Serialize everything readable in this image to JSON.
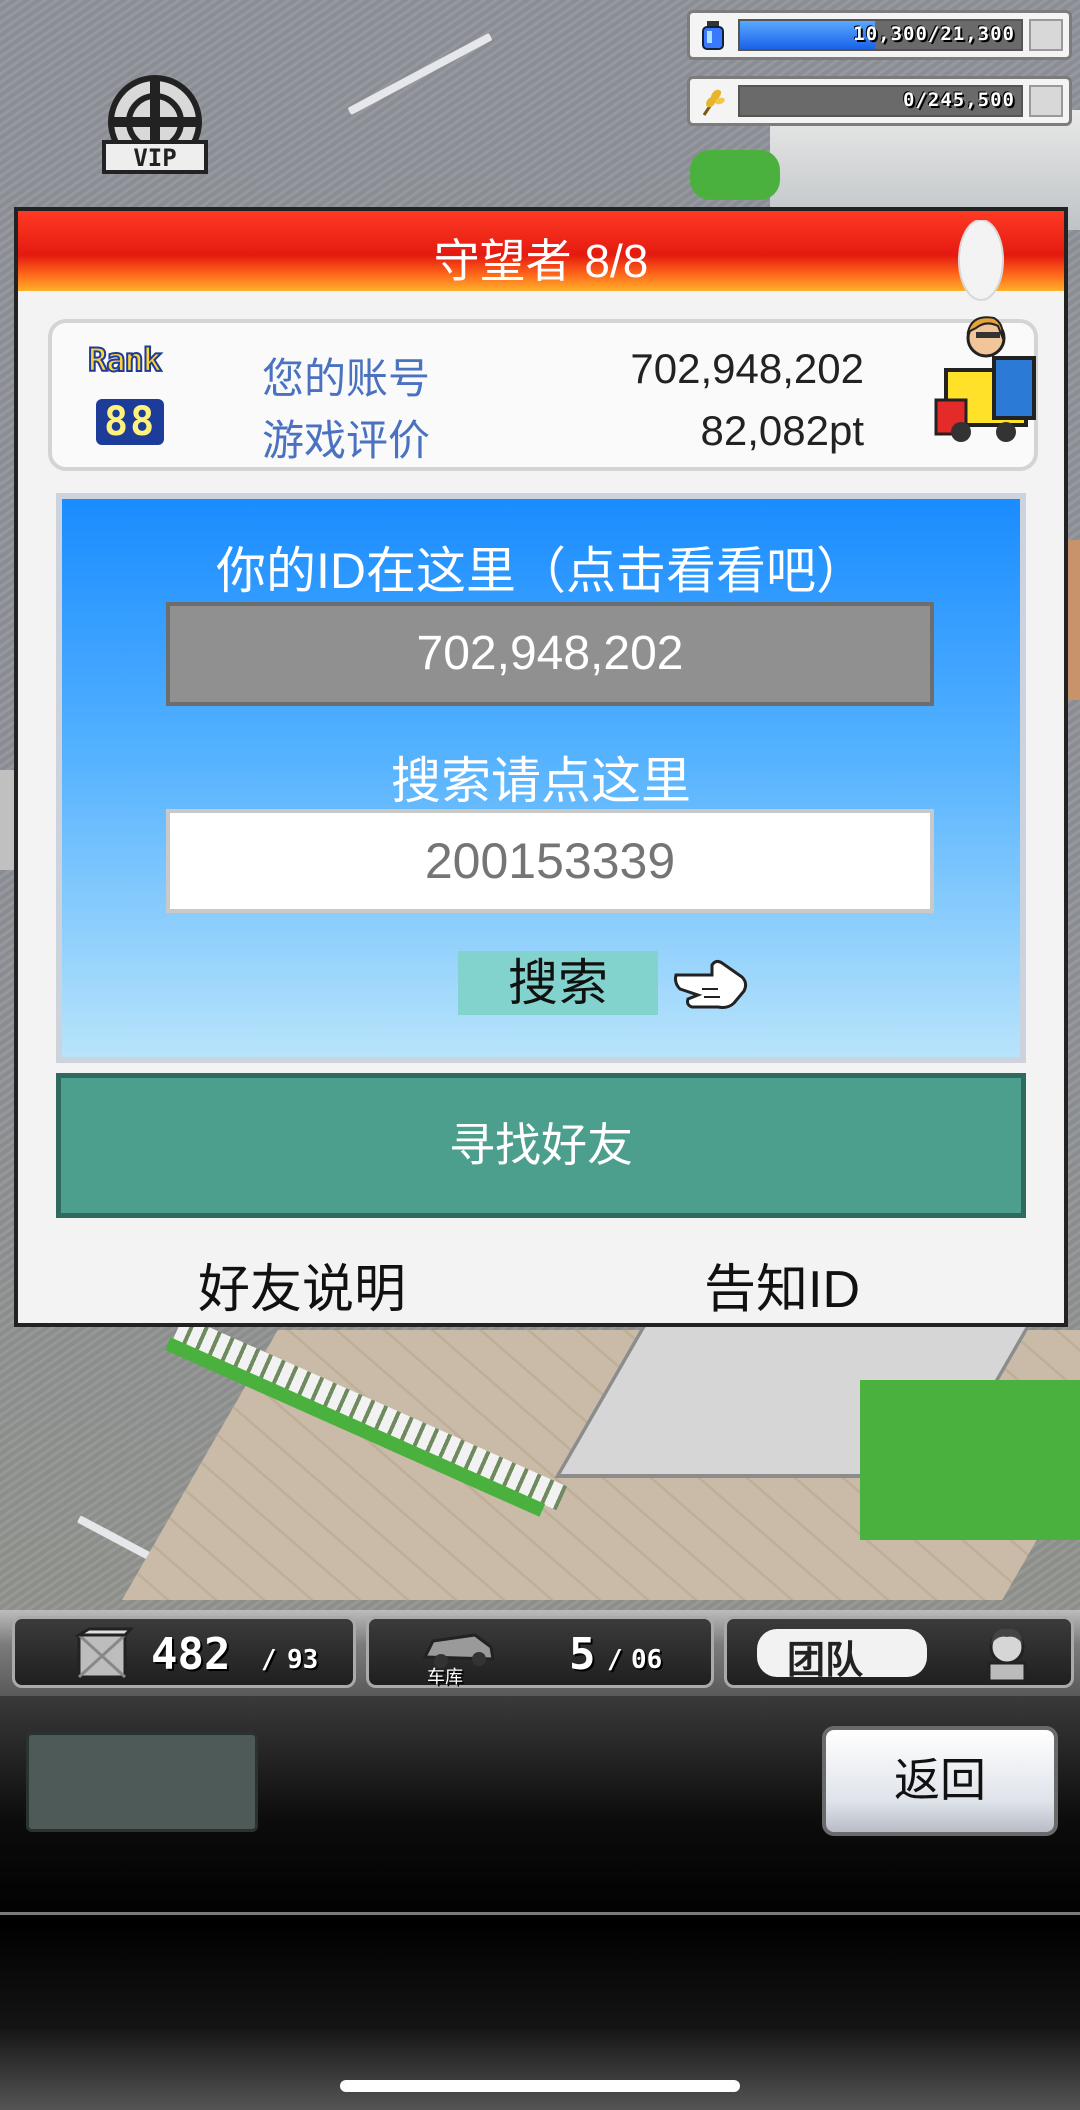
{
  "resources": {
    "energy": {
      "value": "10,300/21,300",
      "fraction": 0.48,
      "icon": "energy-bottle-icon"
    },
    "harvest": {
      "value": "0/245,500",
      "fraction": 0.0,
      "icon": "wheat-icon"
    }
  },
  "vip_badge": {
    "icon": "vip-wheel-icon"
  },
  "dialog": {
    "title": "守望者 8/8",
    "rank": {
      "word": "Rank",
      "number": "88"
    },
    "account_label": "您的账号",
    "account_value": "702,948,202",
    "rating_label": "游戏评价",
    "rating_value": "82,082pt",
    "id_hint": "你的ID在这里（点击看看吧）",
    "id_value": "702,948,202",
    "search_hint": "搜索请点这里",
    "search_placeholder": "200153339",
    "search_button": "搜索",
    "find_friends": "寻找好友",
    "friend_help": "好友说明",
    "notify_id": "告知ID"
  },
  "hud": {
    "crates": {
      "current": "482",
      "max": "93"
    },
    "garage": {
      "label": "车库",
      "current": "5",
      "max": "06"
    },
    "team": {
      "label": "团队"
    }
  },
  "toolbar": {
    "back_label": "返回"
  },
  "colors": {
    "title_red": "#e41a10",
    "find_green": "#4d9f8d",
    "search_teal": "#82d3cd"
  }
}
